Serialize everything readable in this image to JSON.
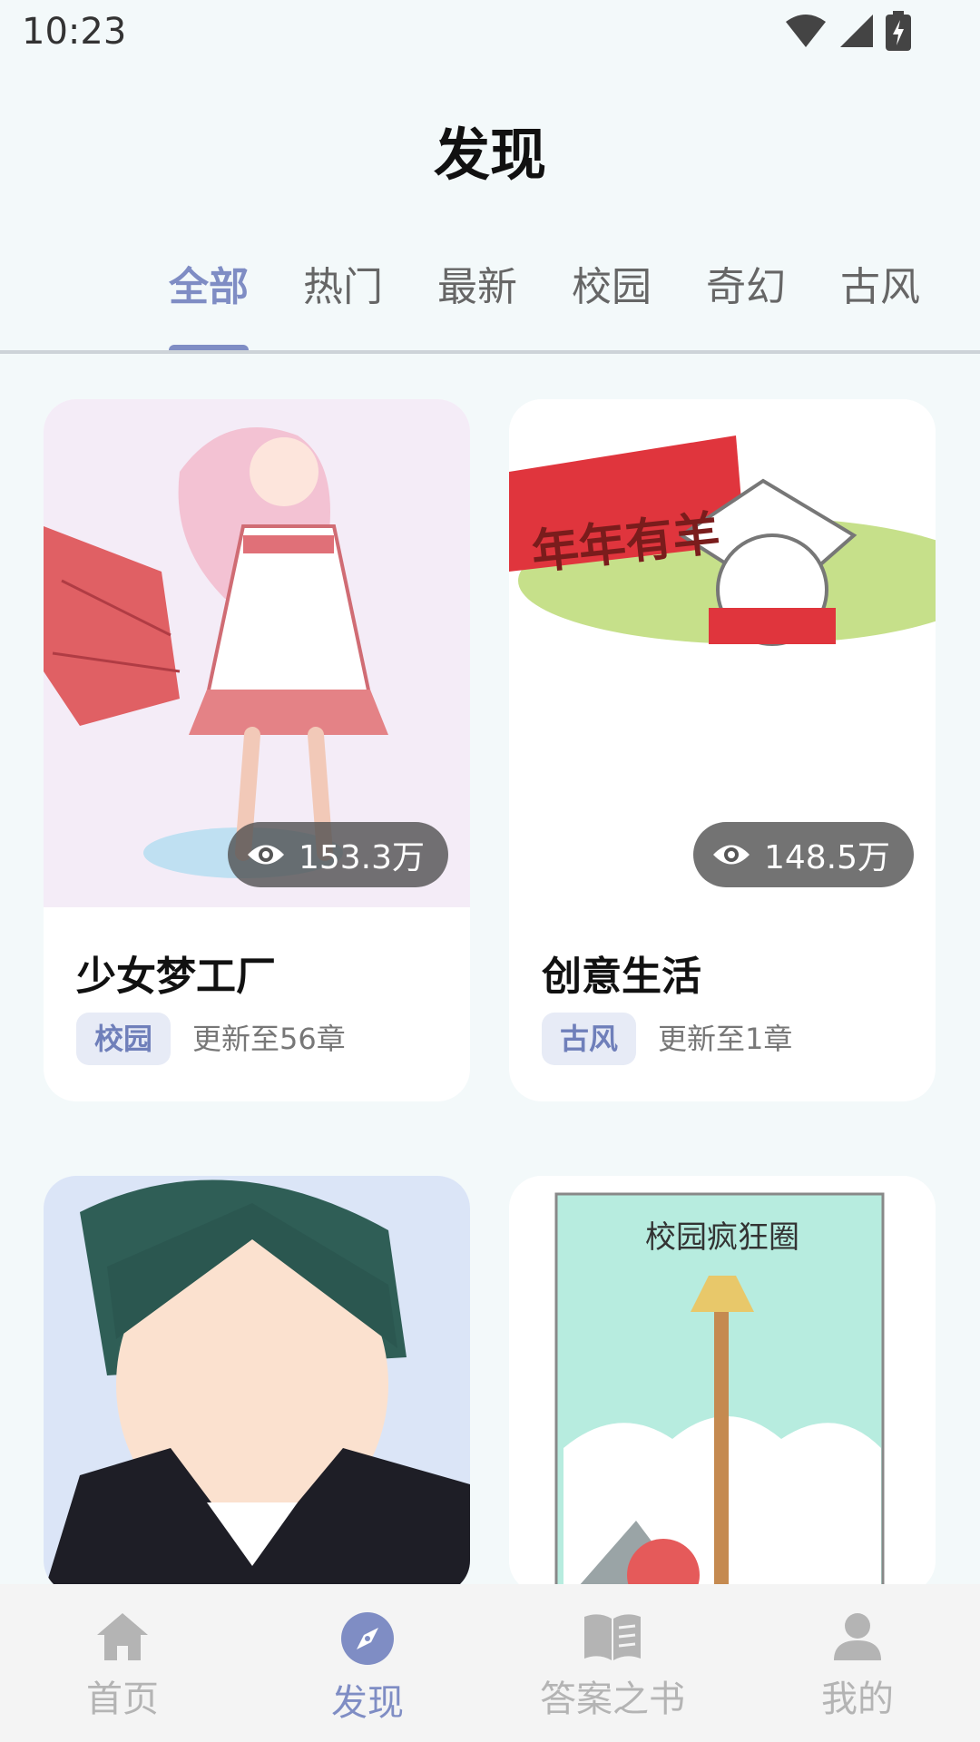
{
  "status": {
    "time": "10:23"
  },
  "page_title": "发现",
  "tabs": [
    {
      "label": "全部"
    },
    {
      "label": "热门"
    },
    {
      "label": "最新"
    },
    {
      "label": "校园"
    },
    {
      "label": "奇幻"
    },
    {
      "label": "古风"
    }
  ],
  "cards": [
    {
      "title": "少女梦工厂",
      "views": "153.3万",
      "tag": "校园",
      "chapter": "更新至56章"
    },
    {
      "title": "创意生活",
      "views": "148.5万",
      "tag": "古风",
      "chapter": "更新至1章",
      "cover_text": "年年有羊"
    },
    {
      "title": "",
      "views": "",
      "tag": "",
      "chapter": ""
    },
    {
      "title": "",
      "views": "",
      "tag": "",
      "chapter": "",
      "cover_text": "校园疯狂圈"
    }
  ],
  "bottom_nav": [
    {
      "label": "首页",
      "icon": "home-icon"
    },
    {
      "label": "发现",
      "icon": "compass-icon"
    },
    {
      "label": "答案之书",
      "icon": "book-icon"
    },
    {
      "label": "我的",
      "icon": "person-icon"
    }
  ],
  "colors": {
    "accent": "#7f8dc4",
    "background": "#f3f9fa",
    "inactive": "#b4b4b4"
  }
}
